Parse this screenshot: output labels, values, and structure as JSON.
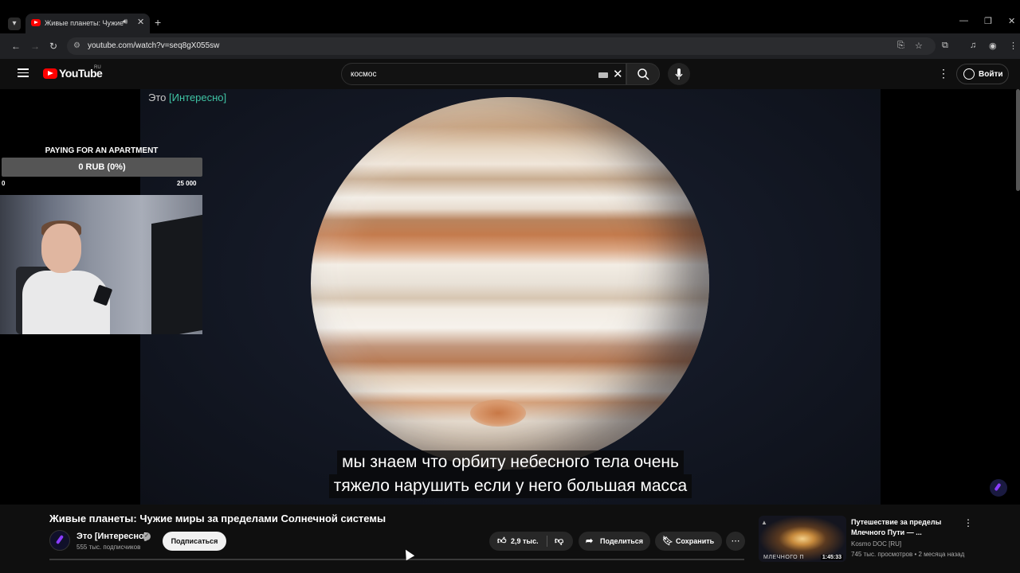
{
  "browser": {
    "tab_title": "Живые планеты: Чужие ми",
    "url": "youtube.com/watch?v=seq8gX055sw",
    "icons": [
      "tab-switcher-icon",
      "youtube-favicon",
      "speaker-icon",
      "close-icon",
      "plus-icon",
      "minimize-icon",
      "restore-icon",
      "close-window-icon",
      "back-icon",
      "forward-icon",
      "reload-icon",
      "site-settings-icon",
      "install-icon",
      "star-icon",
      "extensions-icon",
      "media-icon",
      "profile-icon",
      "menu-icon"
    ]
  },
  "youtube": {
    "logo_text": "YouTube",
    "region": "RU",
    "search_query": "космос",
    "sign_in": "Войти"
  },
  "player": {
    "watermark_prefix": "Это ",
    "watermark_brand": "[Интересно]",
    "subtitle_line1": "мы знаем что орбиту небесного тела очень",
    "subtitle_line2": "тяжело нарушить если у него большая масса"
  },
  "overlay": {
    "goal_title": "PAYING FOR AN APARTMENT",
    "goal_status": "0 RUB (0%)",
    "goal_progress_fraction": 0,
    "goal_min": "0",
    "goal_max": "25 000"
  },
  "video": {
    "title": "Живые планеты: Чужие миры за пределами Солнечной системы",
    "channel": "Это [Интересно]",
    "subscribers": "555 тыс. подписчиков",
    "subscribe": "Подписаться",
    "likes": "2,9 тыс.",
    "share": "Поделиться",
    "save": "Сохранить"
  },
  "recommendation": {
    "title": "Путешествие за пределы Млечного Пути — ...",
    "channel": "Kosmo DOC [RU]",
    "meta": "745 тыс. просмотров • 2 месяца назад",
    "duration": "1:45:33",
    "thumb_caption": "МЛЕЧНОГО П"
  },
  "colors": {
    "youtube_red": "#ff0000",
    "watermark_accent": "#3fc3a4",
    "background": "#0f0f0f"
  }
}
